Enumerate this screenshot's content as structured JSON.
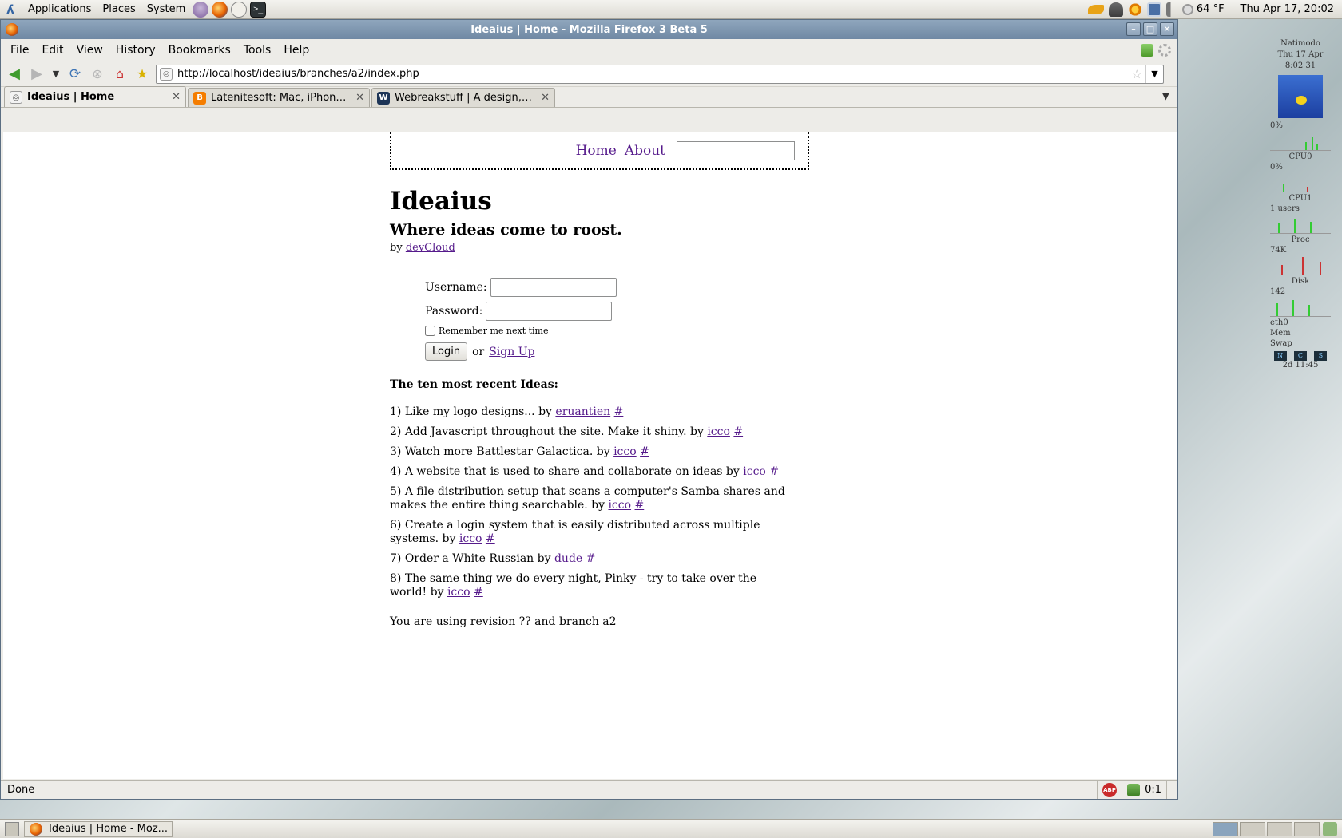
{
  "top_panel": {
    "menus": [
      "Applications",
      "Places",
      "System"
    ],
    "temperature": "64 °F",
    "clock": "Thu Apr 17, 20:02"
  },
  "window": {
    "title": "Ideaius | Home - Mozilla Firefox 3 Beta 5"
  },
  "menubar": {
    "items": [
      "File",
      "Edit",
      "View",
      "History",
      "Bookmarks",
      "Tools",
      "Help"
    ]
  },
  "navbar": {
    "url": "http://localhost/ideaius/branches/a2/index.php"
  },
  "tabs": [
    {
      "title": "Ideaius | Home",
      "active": true
    },
    {
      "title": "Latenitesoft: Mac, iPhone a...",
      "active": false
    },
    {
      "title": "Webreakstuff | A design, de...",
      "active": false
    }
  ],
  "page": {
    "nav": {
      "home": "Home",
      "about": "About",
      "search_value": ""
    },
    "title": "Ideaius",
    "tagline": "Where ideas come to roost.",
    "by_prefix": "by",
    "author": "devCloud",
    "login": {
      "username_label": "Username:",
      "password_label": "Password:",
      "remember_label": "Remember me next time",
      "login_button": "Login",
      "or_text": "or",
      "signup_link": "Sign Up"
    },
    "ideas_heading": "The ten most recent Ideas:",
    "ideas": [
      {
        "text": "1) Like my logo designs... by",
        "author": "eruantien",
        "hash": "#"
      },
      {
        "text": "2) Add Javascript throughout the site. Make it shiny. by",
        "author": "icco",
        "hash": "#"
      },
      {
        "text": "3) Watch more Battlestar Galactica. by",
        "author": "icco",
        "hash": "#"
      },
      {
        "text": "4) A website that is used to share and collaborate on ideas by",
        "author": "icco",
        "hash": "#"
      },
      {
        "text": "5) A file distribution setup that scans a computer's Samba shares and makes the entire thing searchable. by",
        "author": "icco",
        "hash": "#"
      },
      {
        "text": "6) Create a login system that is easily distributed across multiple systems. by",
        "author": "icco",
        "hash": "#"
      },
      {
        "text": "7) Order a White Russian by",
        "author": "dude",
        "hash": "#"
      },
      {
        "text": "8) The same thing we do every night, Pinky - try to take over the world! by",
        "author": "icco",
        "hash": "#"
      }
    ],
    "revision": "You are using revision ?? and branch a2"
  },
  "statusbar": {
    "text": "Done",
    "counter": "0:1",
    "adblock_label": "ABP"
  },
  "desklet": {
    "host": "Natimodo",
    "date": "Thu 17 Apr",
    "time": "8:02 31",
    "cpu0_label": "CPU0",
    "cpu0_pct": "0%",
    "cpu1_label": "CPU1",
    "cpu1_pct": "0%",
    "users": "1 users",
    "proc_label": "Proc",
    "proc_value": "74K",
    "disk_label": "Disk",
    "disk_value": "142",
    "eth0_label": "eth0",
    "mem_label": "Mem",
    "swap_label": "Swap",
    "chips": [
      "N",
      "C",
      "S"
    ],
    "uptime": "2d 11:45"
  },
  "taskbar": {
    "task_title": "Ideaius | Home - Moz..."
  }
}
